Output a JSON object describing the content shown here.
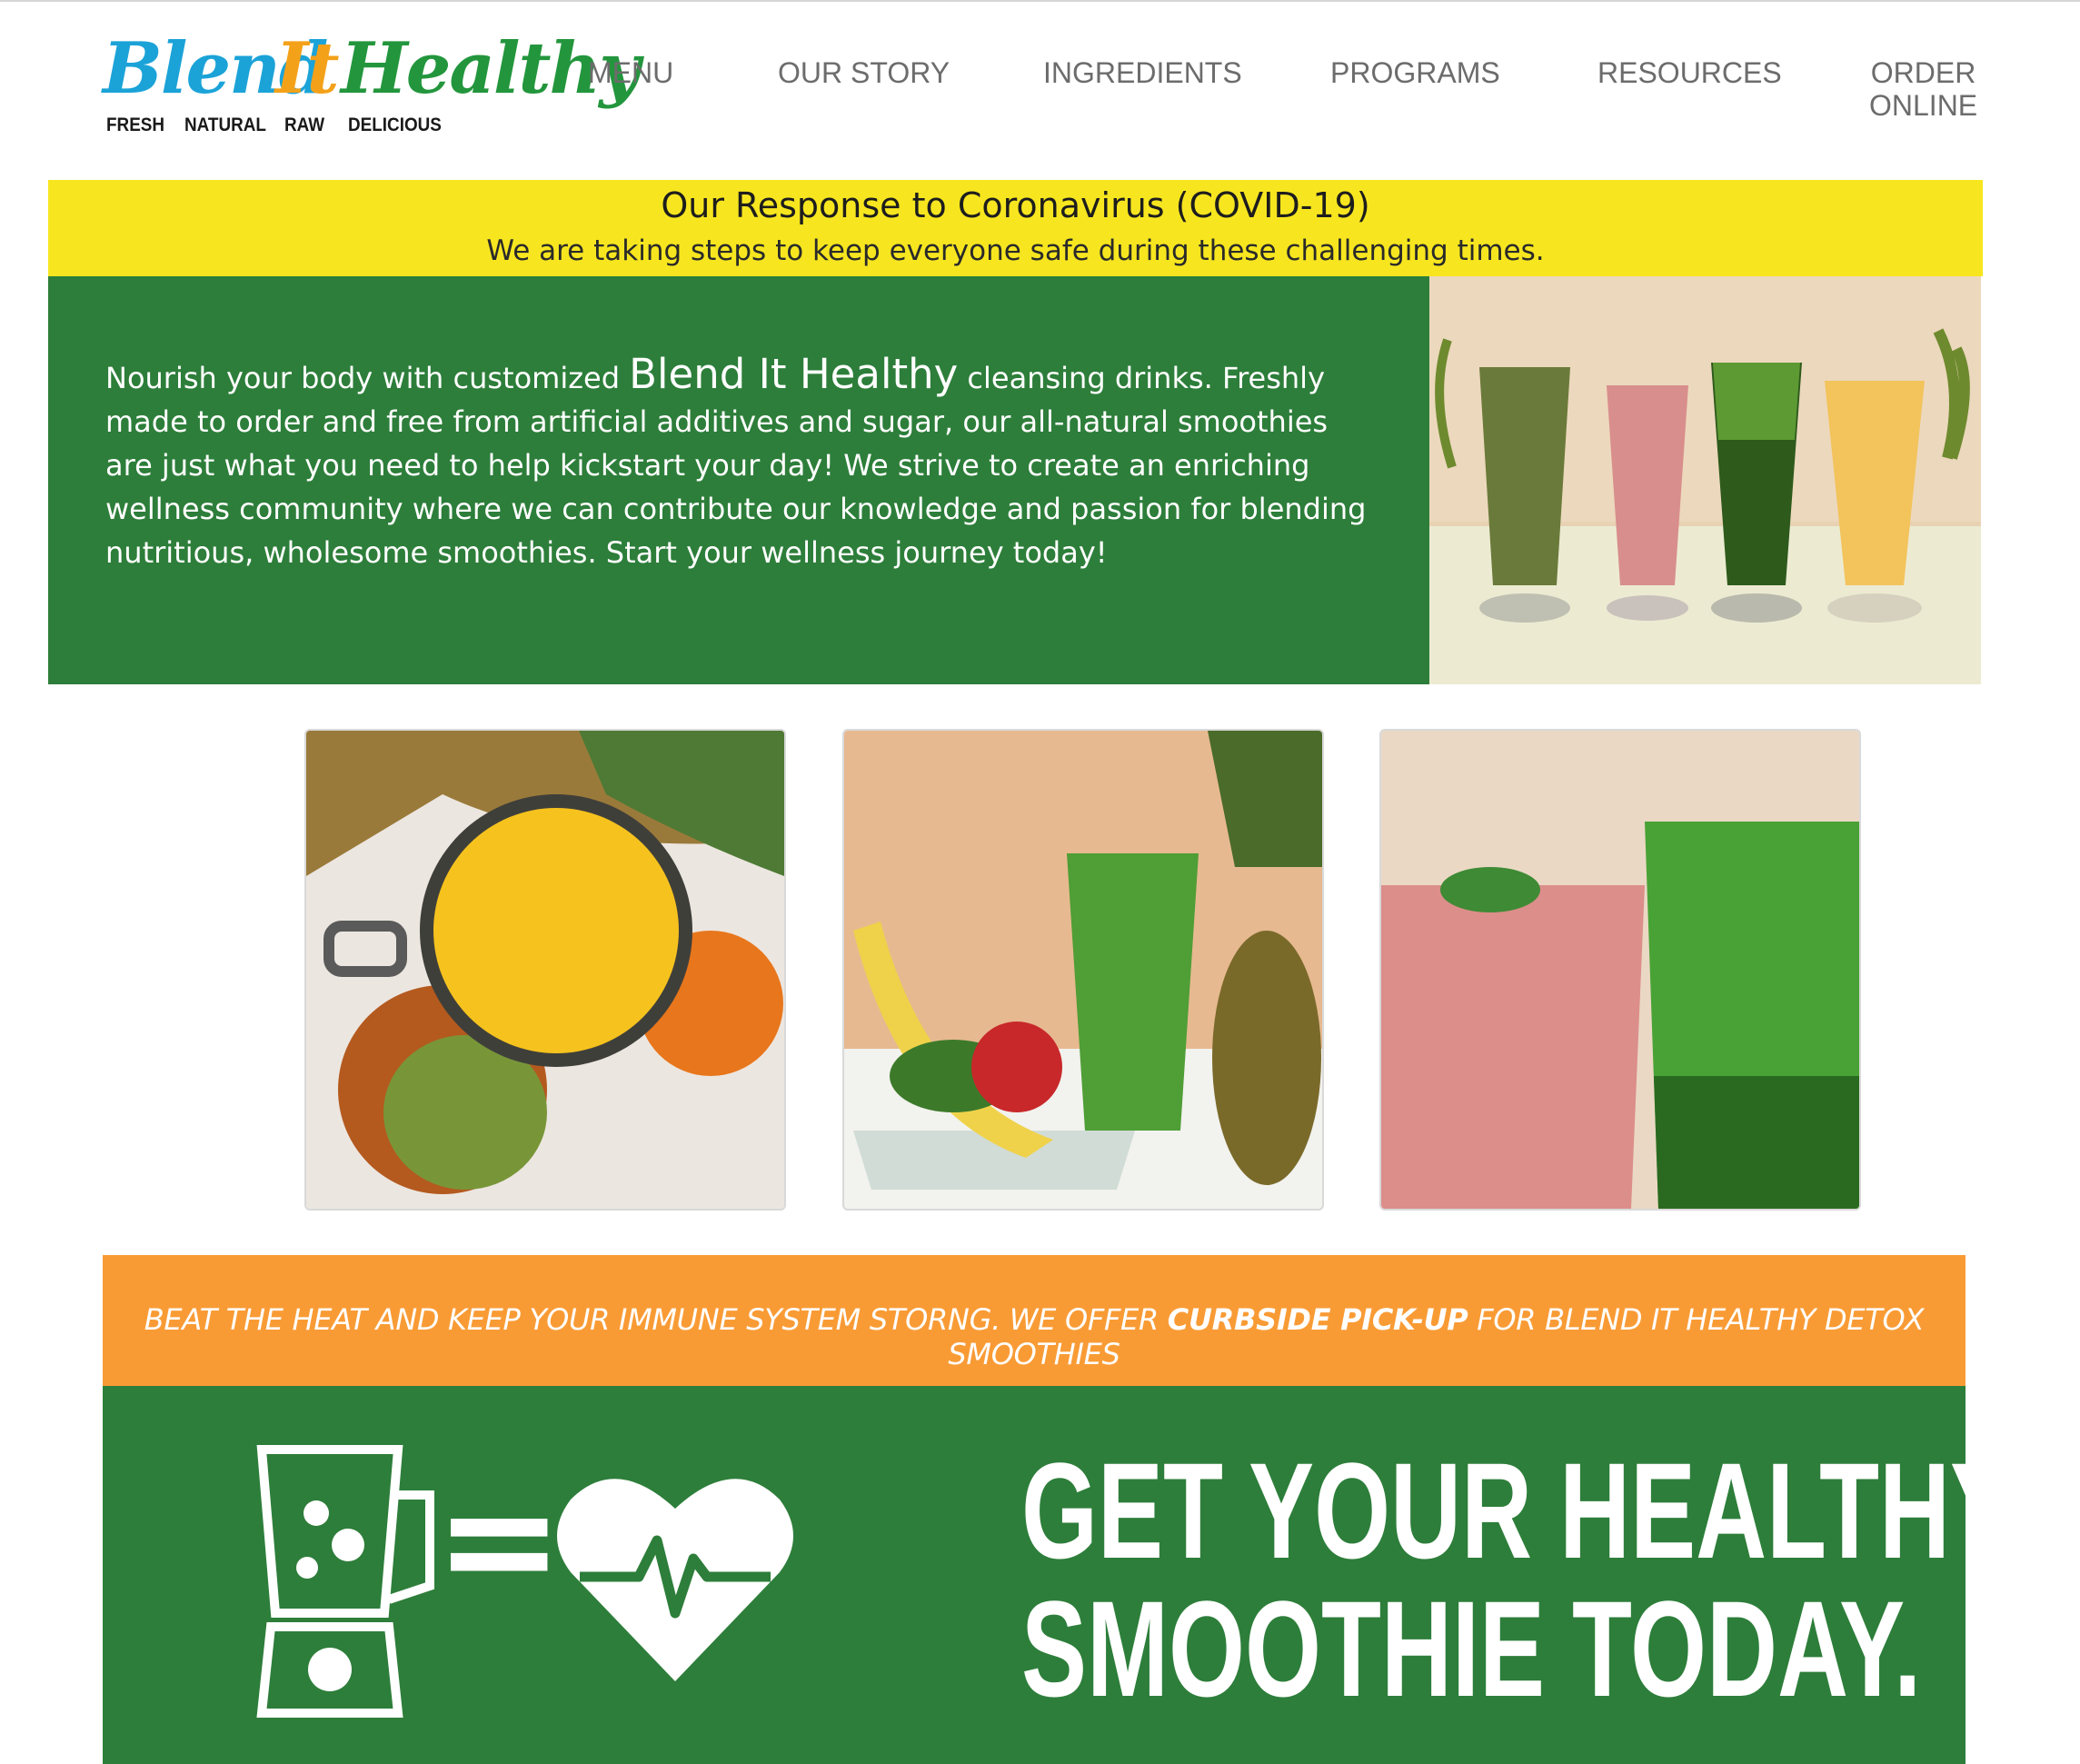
{
  "brand": {
    "logo_words": [
      "Blend",
      "It",
      "Healthy"
    ],
    "tagline": [
      "FRESH",
      "NATURAL",
      "RAW",
      "DELICIOUS"
    ],
    "colors": {
      "blue": "#1ba3d8",
      "orange": "#f4a11a",
      "green": "#23963d"
    }
  },
  "nav": {
    "items": [
      {
        "label": "MENU"
      },
      {
        "label": "OUR STORY"
      },
      {
        "label": "INGREDIENTS"
      },
      {
        "label": "PROGRAMS"
      },
      {
        "label": "RESOURCES"
      },
      {
        "label_line1": "ORDER",
        "label_line2": "ONLINE"
      }
    ]
  },
  "covid": {
    "title": "Our Response to Coronavirus (COVID-19)",
    "subtitle": "We are taking steps to keep everyone safe during these challenging times.",
    "color": "#f7e61f"
  },
  "hero": {
    "text_before": "Nourish your body with customized ",
    "brand_name": "Blend It Healthy",
    "text_after": " cleansing drinks. Freshly made to order and free from artificial additives and sugar, our all-natural smoothies are just what you need to help kickstart your day! We strive to create an enriching wellness community where we can contribute our knowledge and passion for blending nutritious, wholesome smoothies. Start your wellness journey today!",
    "color": "#2d7e3a"
  },
  "promo": {
    "text_before": "BEAT THE HEAT AND KEEP YOUR IMMUNE SYSTEM STORNG. WE OFFER ",
    "bold": "CURBSIDE PICK-UP",
    "text_after": " FOR BLEND IT HEALTHY DETOX SMOOTHIES",
    "color": "#f99b35"
  },
  "cta": {
    "line1": "GET YOUR HEALTHY",
    "line2": "SMOOTHIE TODAY.",
    "equals": "=",
    "icons": [
      "blender-icon",
      "heart-pulse-icon"
    ]
  }
}
